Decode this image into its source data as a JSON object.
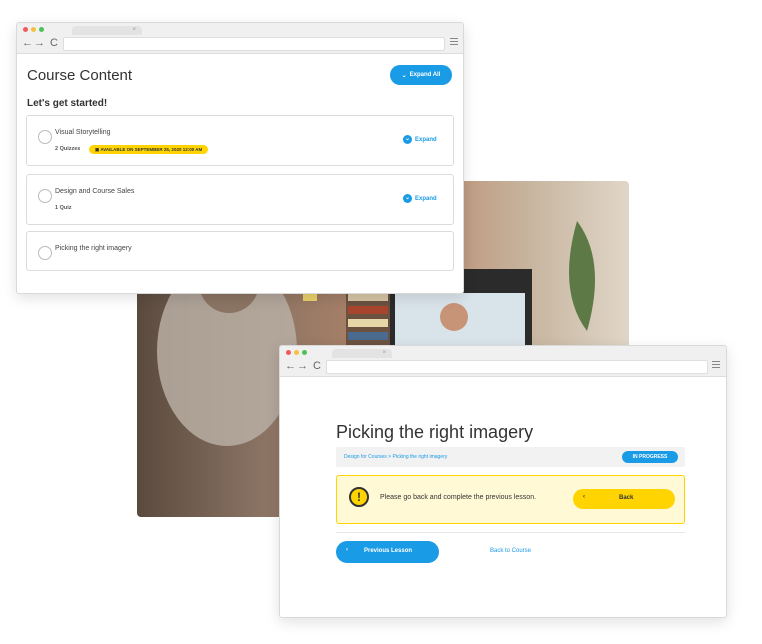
{
  "course_window": {
    "title": "Course Content",
    "expand_all": "Expand All",
    "section_heading": "Let's get started!",
    "lessons": [
      {
        "title": "Visual Storytelling",
        "meta": "2 Quizzes",
        "badge": "AVAILABLE ON SEPTEMBER 25, 2020 12:00 AM",
        "expand": "Expand"
      },
      {
        "title": "Design and Course Sales",
        "meta": "1 Quiz",
        "expand": "Expand"
      },
      {
        "title": "Picking the right imagery"
      }
    ]
  },
  "lesson_window": {
    "title": "Picking the right imagery",
    "breadcrumb": "Design for Courses > Picking the right imagery",
    "status": "IN PROGRESS",
    "alert_icon": "!",
    "alert_text": "Please go back and complete the previous lesson.",
    "back_button": "Back",
    "previous_lesson": "Previous Lesson",
    "back_to_course": "Back to Course"
  },
  "browser": {
    "nav_glyphs": "←→ C",
    "tab_close": "×"
  },
  "colors": {
    "accent": "#1a9be6",
    "warning": "#ffd400",
    "dot_red": "#f05a5a",
    "dot_yellow": "#f6c143",
    "dot_green": "#4cc15a"
  }
}
